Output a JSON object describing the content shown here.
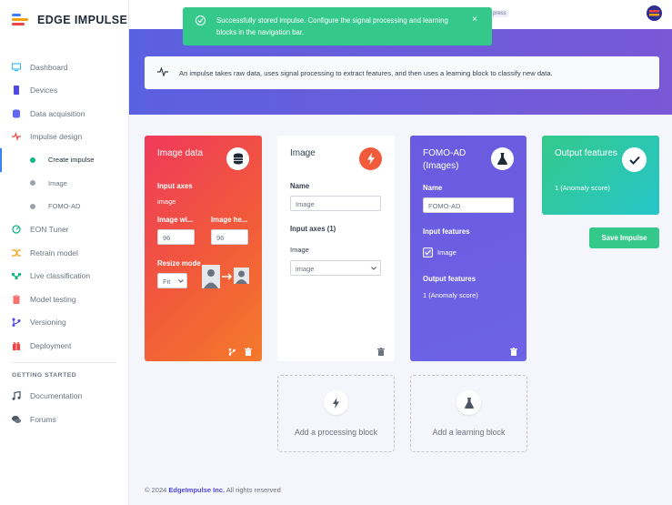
{
  "app": {
    "logo_text": "EDGE IMPULSE",
    "press_tag": "press"
  },
  "sidebar": {
    "items": [
      {
        "label": "Dashboard",
        "icon": "monitor-icon",
        "color": "#38bdf8"
      },
      {
        "label": "Devices",
        "icon": "device-icon",
        "color": "#4f46e5"
      },
      {
        "label": "Data acquisition",
        "icon": "database-icon",
        "color": "#6366f1"
      },
      {
        "label": "Impulse design",
        "icon": "pulse-icon",
        "color": "#ef4444"
      }
    ],
    "subitems": [
      {
        "label": "Create impulse",
        "active": true
      },
      {
        "label": "Image",
        "active": false
      },
      {
        "label": "FOMO-AD",
        "active": false
      }
    ],
    "items2": [
      {
        "label": "EON Tuner",
        "icon": "tuner-icon",
        "color": "#10b981"
      },
      {
        "label": "Retrain model",
        "icon": "shuffle-icon",
        "color": "#f59e0b"
      },
      {
        "label": "Live classification",
        "icon": "live-icon",
        "color": "#10b981"
      },
      {
        "label": "Model testing",
        "icon": "clipboard-icon",
        "color": "#ef4444"
      },
      {
        "label": "Versioning",
        "icon": "branch-icon",
        "color": "#4f46e5"
      },
      {
        "label": "Deployment",
        "icon": "gift-icon",
        "color": "#ef4444"
      }
    ],
    "section_title": "GETTING STARTED",
    "items3": [
      {
        "label": "Documentation",
        "icon": "music-icon"
      },
      {
        "label": "Forums",
        "icon": "chat-icon"
      }
    ]
  },
  "toast": {
    "message": "Successfully stored impulse. Configure the signal processing and learning blocks in the navigation bar.",
    "close": "×"
  },
  "info": {
    "text": "An impulse takes raw data, uses signal processing to extract features, and then uses a learning block to classify new data."
  },
  "image_data": {
    "title": "Image data",
    "input_axes_label": "Input axes",
    "input_axes_value": "image",
    "width_label": "Image wi...",
    "height_label": "Image he...",
    "width_value": "96",
    "height_value": "96",
    "resize_label": "Resize mode",
    "resize_value": "Fit"
  },
  "processing": {
    "title": "Image",
    "name_label": "Name",
    "name_value": "Image",
    "axes_label": "Input axes (1)",
    "axes_item": "Image",
    "axes_select": "image"
  },
  "learning": {
    "title": "FOMO-AD (Images)",
    "name_label": "Name",
    "name_value": "FOMO-AD",
    "features_label": "Input features",
    "feature_item": "Image",
    "output_label": "Output features",
    "output_value": "1 (Anomaly score)"
  },
  "output": {
    "title": "Output features",
    "value": "1 (Anomaly score)",
    "save_label": "Save Impulse"
  },
  "add_processing": {
    "label": "Add a processing block"
  },
  "add_learning": {
    "label": "Add a learning block"
  },
  "footer": {
    "copy": "© 2024 ",
    "company": "EdgeImpulse Inc.",
    "rest": " All rights reserved"
  }
}
